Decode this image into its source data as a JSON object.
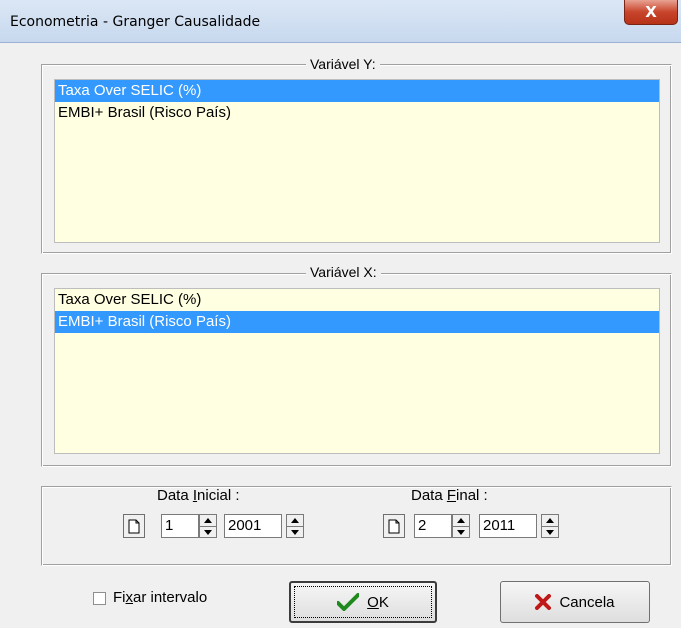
{
  "window": {
    "title": "Econometria - Granger Causalidade",
    "close_glyph": "X"
  },
  "var_y": {
    "legend": "Variável Y:",
    "items": [
      "Taxa Over SELIC (%)",
      "EMBI+ Brasil (Risco País)"
    ],
    "selected_index": 0
  },
  "var_x": {
    "legend": "Variável X:",
    "items": [
      "Taxa Over SELIC (%)",
      "EMBI+ Brasil (Risco País)"
    ],
    "selected_index": 1
  },
  "dates": {
    "start_label_pre": "Data ",
    "start_label_u": "I",
    "start_label_post": "nicial :",
    "start_month": "1",
    "start_year": "2001",
    "end_label_pre": "Data ",
    "end_label_u": "F",
    "end_label_post": "inal :",
    "end_month": "2",
    "end_year": "2011"
  },
  "footer": {
    "fix_pre": "Fi",
    "fix_u": "x",
    "fix_post": "ar intervalo",
    "fix_checked": false,
    "ok_u": "O",
    "ok_post": "K",
    "cancel_label": "Cancela"
  },
  "colors": {
    "selection": "#3399ff",
    "list_bg": "#ffffe1",
    "ok_check": "#1e8a1e",
    "cancel_x": "#c01818"
  },
  "icons": {
    "ok": "check-icon",
    "cancel": "x-icon",
    "calendar": "page-icon"
  }
}
